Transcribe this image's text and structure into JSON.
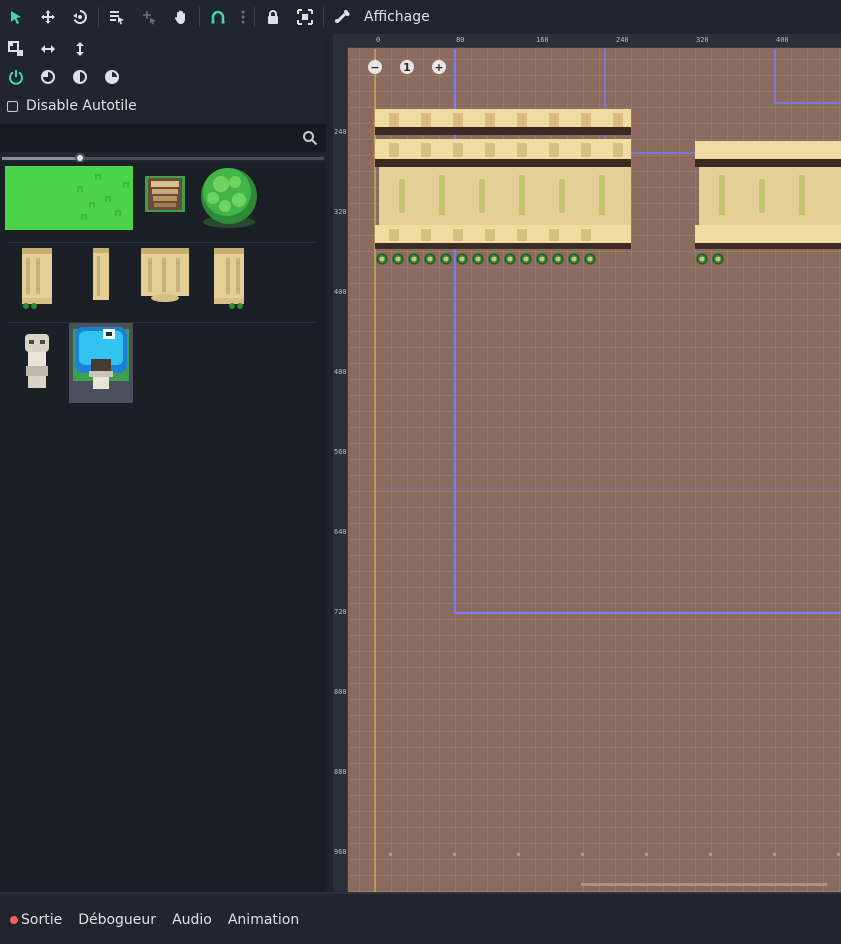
{
  "toolbar": {
    "view_menu_label": "Affichage",
    "accent_color": "#45d7a5"
  },
  "tile_panel": {
    "autotile_label": "Disable Autotile",
    "autotile_checked": false,
    "search_placeholder": "",
    "zoom_level": 0.24
  },
  "viewport": {
    "zoom_reset_label": "1",
    "ruler_top": [
      "0",
      "80",
      "160",
      "240",
      "320",
      "400"
    ],
    "ruler_left": [
      "240",
      "320",
      "400",
      "480",
      "560",
      "640",
      "720",
      "800",
      "880",
      "960"
    ],
    "background_color": "#8a6b5e",
    "guide_color": "#7b7bff"
  },
  "bottom_panel": {
    "tabs": [
      "Sortie",
      "Débogueur",
      "Audio",
      "Animation"
    ],
    "output_indicator_color": "#ff5d5d"
  }
}
